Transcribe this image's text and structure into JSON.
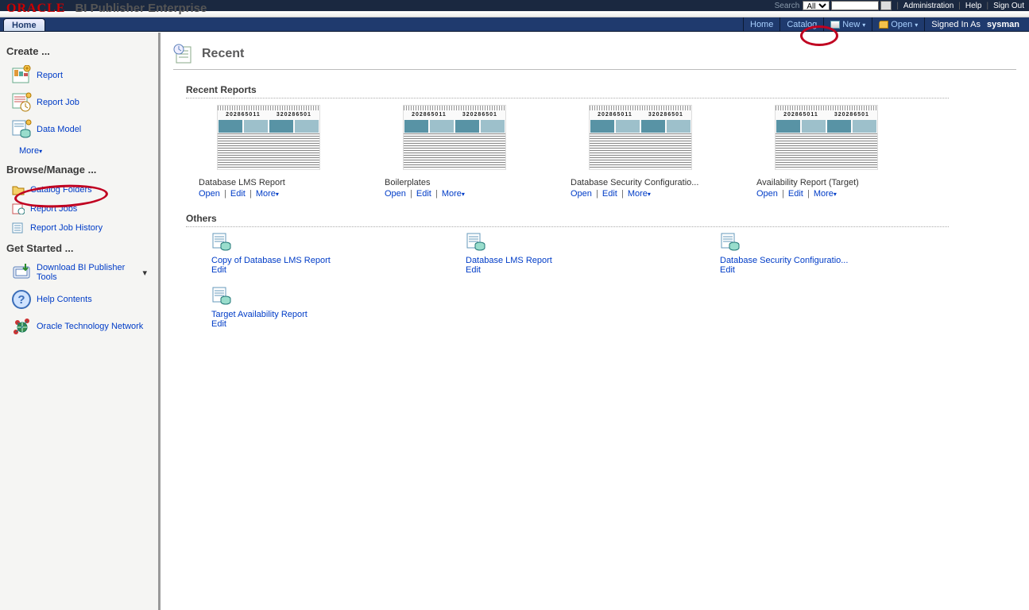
{
  "brand": "ORACLE",
  "appTitle": "BI Publisher Enterprise",
  "topbar": {
    "searchLabel": "Search",
    "searchScope": "All",
    "links": [
      "Administration",
      "Help",
      "Sign Out"
    ]
  },
  "tabs": {
    "home": "Home"
  },
  "nav": {
    "home": "Home",
    "catalog": "Catalog",
    "new": "New",
    "open": "Open",
    "signedInAs": "Signed In As",
    "user": "sysman"
  },
  "sidebar": {
    "createHeader": "Create ...",
    "create": [
      {
        "label": "Report",
        "icon": "report-icon"
      },
      {
        "label": "Report Job",
        "icon": "report-job-icon"
      },
      {
        "label": "Data Model",
        "icon": "data-model-icon"
      }
    ],
    "more": "More",
    "browseHeader": "Browse/Manage ...",
    "browse": [
      {
        "label": "Catalog Folders",
        "icon": "folder-icon"
      },
      {
        "label": "Report Jobs",
        "icon": "report-jobs-icon"
      },
      {
        "label": "Report Job History",
        "icon": "history-icon"
      }
    ],
    "getStartedHeader": "Get Started ...",
    "getStarted": [
      {
        "label": "Download BI Publisher Tools",
        "icon": "download-icon",
        "dropdown": true
      },
      {
        "label": "Help Contents",
        "icon": "help-icon"
      },
      {
        "label": "Oracle Technology Network",
        "icon": "otn-icon"
      }
    ]
  },
  "page": {
    "title": "Recent",
    "sections": {
      "recentReports": "Recent Reports",
      "others": "Others"
    },
    "thumbNums": [
      "202865011",
      "320286501"
    ],
    "actions": {
      "open": "Open",
      "edit": "Edit",
      "more": "More"
    },
    "recent": [
      {
        "title": "Database LMS Report"
      },
      {
        "title": "Boilerplates"
      },
      {
        "title": "Database Security Configuratio..."
      },
      {
        "title": "Availability Report (Target)"
      }
    ],
    "others": [
      {
        "title": "Copy of Database LMS Report"
      },
      {
        "title": "Database LMS Report"
      },
      {
        "title": "Database Security Configuratio..."
      },
      {
        "title": "Target Availability Report"
      }
    ]
  }
}
